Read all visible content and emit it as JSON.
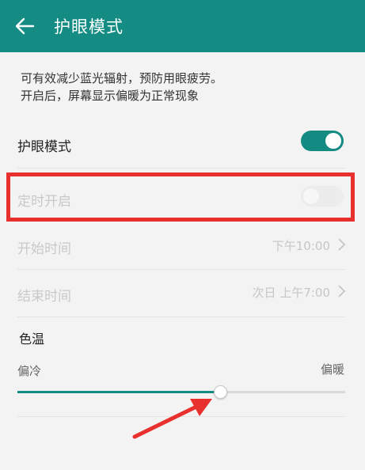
{
  "header": {
    "title": "护眼模式",
    "back_icon": "back-arrow-icon",
    "bg_color": "#148c84"
  },
  "description": {
    "line1": "可有效减少蓝光辐射，预防用眼疲劳。",
    "line2": "开启后，屏幕显示偏暖为正常现象"
  },
  "eye_comfort": {
    "label": "护眼模式",
    "enabled": true
  },
  "scheduled": {
    "label": "定时开启",
    "enabled": false
  },
  "start_time": {
    "label": "开始时间",
    "value": "下午10:00"
  },
  "end_time": {
    "label": "结束时间",
    "value": "次日 上午7:00"
  },
  "color_temperature": {
    "section_title": "色温",
    "cool_label": "偏冷",
    "warm_label": "偏暖",
    "level": 0.62
  },
  "colors": {
    "accent": "#148c84",
    "annotation_red": "#e8312f"
  }
}
